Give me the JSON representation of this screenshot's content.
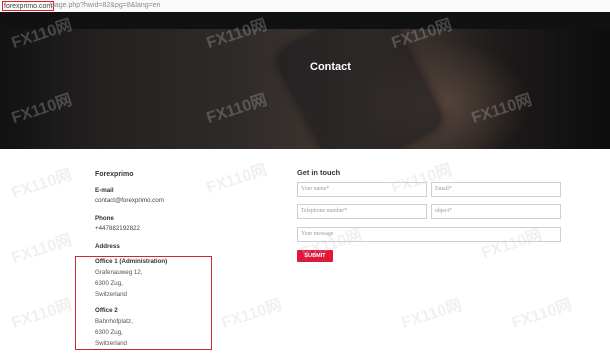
{
  "browser": {
    "domain": "forexprimo.com",
    "path": "/page.php?hwid=82&pg=8&lang=en"
  },
  "hero": {
    "title": "Contact"
  },
  "contact_info": {
    "company": "Forexprimo",
    "email_label": "E-mail",
    "email": "contact@forexprimo.com",
    "phone_label": "Phone",
    "phone": "+447882192822",
    "address_label": "Address",
    "offices": [
      {
        "title": "Office 1 (Administration)",
        "lines": [
          "Grafenauweg 12,",
          "6300 Zug,",
          "Switzerland"
        ]
      },
      {
        "title": "Office 2",
        "lines": [
          "Bahnhofplatz,",
          "6300 Zug,",
          "Switzerland"
        ]
      }
    ]
  },
  "form": {
    "heading": "Get in touch",
    "name_placeholder": "Your name*",
    "email_placeholder": "Email*",
    "phone_placeholder": "Telephone number*",
    "object_placeholder": "object*",
    "message_placeholder": "Your message",
    "submit_label": "SUBMIT"
  },
  "watermark": {
    "text": "FX110网"
  },
  "colors": {
    "accent": "#e0193a",
    "highlight_border": "#d0263a",
    "hero_overlay": "#2a2624"
  }
}
